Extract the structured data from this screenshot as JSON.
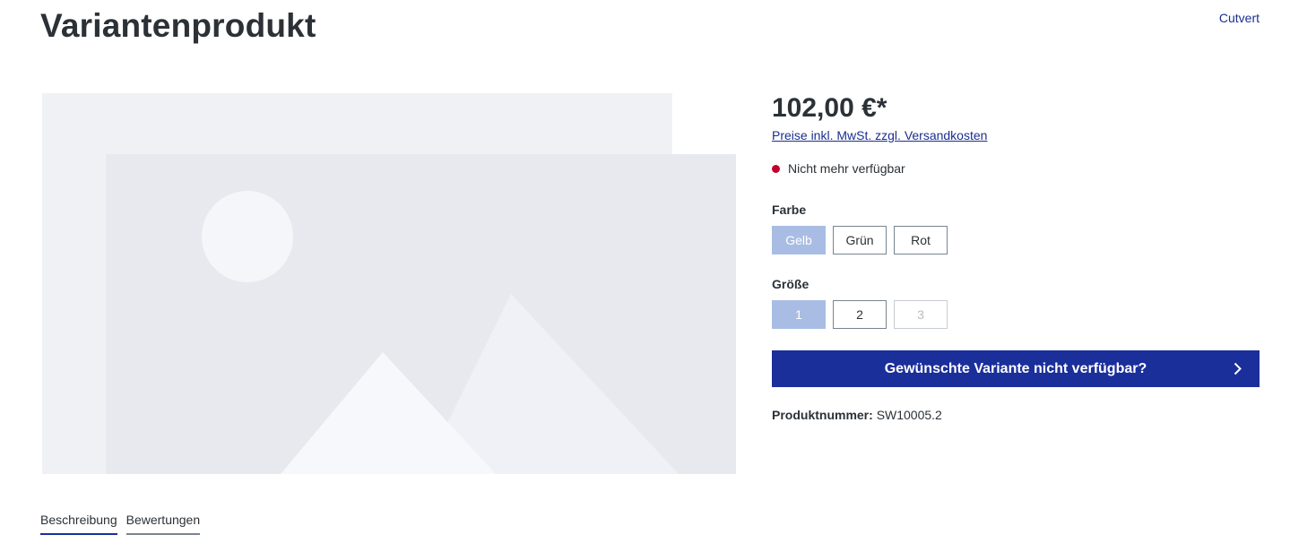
{
  "product": {
    "title": "Variantenprodukt",
    "manufacturer": "Cutvert",
    "price": "102,00 €*",
    "tax_note": "Preise inkl. MwSt. zzgl. Versandkosten",
    "availability": "Nicht mehr verfügbar",
    "availability_color": "#c2002f",
    "number_label": "Produktnummer:",
    "number_value": "SW10005.2"
  },
  "options": {
    "farbe": {
      "label": "Farbe",
      "values": [
        {
          "label": "Gelb",
          "state": "selected"
        },
        {
          "label": "Grün",
          "state": "available"
        },
        {
          "label": "Rot",
          "state": "available"
        }
      ]
    },
    "groesse": {
      "label": "Größe",
      "values": [
        {
          "label": "1",
          "state": "selected"
        },
        {
          "label": "2",
          "state": "available"
        },
        {
          "label": "3",
          "state": "disabled"
        }
      ]
    }
  },
  "cta": {
    "label": "Gewünschte Variante nicht verfügbar?",
    "icon": "chevron-right-icon",
    "color": "#1a2f9a"
  },
  "tabs": [
    {
      "label": "Beschreibung",
      "active": true
    },
    {
      "label": "Bewertungen",
      "active": false
    }
  ],
  "gallery": {
    "icon": "image-placeholder-icon"
  }
}
